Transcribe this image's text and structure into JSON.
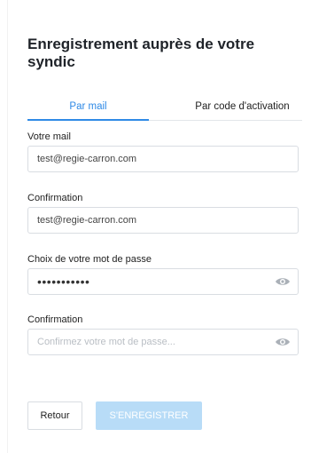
{
  "form": {
    "title": "Enregistrement auprès de votre syndic",
    "tabs": [
      {
        "label": "Par mail",
        "active": true
      },
      {
        "label": "Par code d'activation",
        "active": false
      }
    ],
    "email": {
      "label": "Votre mail",
      "value": "test@regie-carron.com"
    },
    "email_confirm": {
      "label": "Confirmation",
      "value": "test@regie-carron.com"
    },
    "password": {
      "label": "Choix de votre mot de passe",
      "masked_value": "•••••••••••"
    },
    "password_confirm": {
      "label": "Confirmation",
      "placeholder": "Confirmez votre mot de passe..."
    },
    "buttons": {
      "back": "Retour",
      "register": "S'ENREGISTRER"
    }
  },
  "colors": {
    "accent": "#2f8ae6",
    "disabled_button": "#b8dcf7",
    "border": "#d9dde2",
    "placeholder": "#b9bec4"
  },
  "icons": [
    "eye-icon"
  ]
}
